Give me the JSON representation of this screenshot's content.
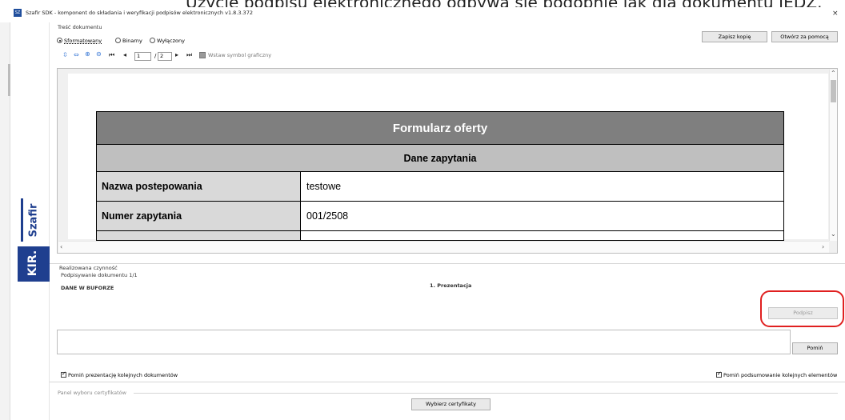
{
  "overlay_caption": "Użycie podpisu elektronicznego odbywa się podobnie jak dla dokumentu JEDZ.",
  "window": {
    "icon_text": "SZ",
    "title": "Szafir SDK - komponent do składania i weryfikacji podpisów elektronicznych v1.8.3.372",
    "close_glyph": "×"
  },
  "sidebar": {
    "brand": "Szafir",
    "logo": "KIR."
  },
  "content_group": {
    "label": "Treść dokumentu",
    "radios": [
      {
        "label": "Sformatowany",
        "selected": true
      },
      {
        "label": "Binarny",
        "selected": false
      },
      {
        "label": "Wyłączony",
        "selected": false
      }
    ],
    "save_copy": "Zapisz kopię",
    "open_with": "Otwórz za pomocą"
  },
  "toolbar": {
    "page_current": "1",
    "page_sep": "/",
    "page_total": "2",
    "insert_label": "Wstaw symbol graficzny"
  },
  "document": {
    "title": "Formularz oferty",
    "section": "Dane zapytania",
    "rows": [
      {
        "label": "Nazwa postepowania",
        "value": "testowe"
      },
      {
        "label": "Numer zapytania",
        "value": "001/2508"
      }
    ]
  },
  "action_group": {
    "label": "Realizowana czynność",
    "progress": "Podpisywanie dokumentu 1/1",
    "buffer": "DANE W BUFORZE",
    "stage": "1. Prezentacja",
    "sign_button": "Podpisz",
    "skip_button": "Pomiń",
    "skip_presentations": "Pomiń prezentację kolejnych dokumentów",
    "skip_summary": "Pomiń podsumowanie kolejnych elementów"
  },
  "cert_panel": {
    "label": "Panel wyboru certyfikatów",
    "choose_button": "Wybierz certyfikaty"
  },
  "colors": {
    "brand": "#1f3f8f",
    "highlight": "#e02020",
    "table_header": "#7f7f7f",
    "table_subheader": "#bfbfbf",
    "table_label": "#d9d9d9"
  }
}
